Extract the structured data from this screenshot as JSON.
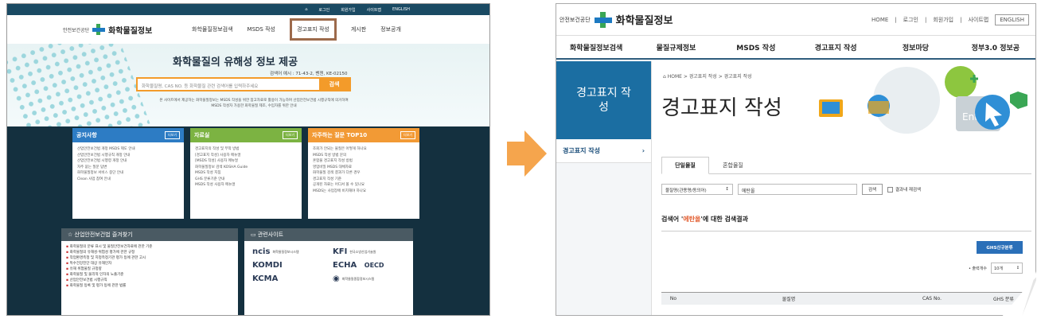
{
  "left_page": {
    "top_util": [
      "⌂",
      "로그인",
      "회원가입",
      "사이트맵",
      "ENGLISH"
    ],
    "org": "안전보건공단",
    "site_name": "화학물질정보",
    "nav": [
      "화학물질정보검색",
      "MSDS 작성",
      "경고표지 작성",
      "게시판",
      "정보공개"
    ],
    "hero_title": "화학물질의 유해성 정보 제공",
    "hero_sub": "검색어 예시 : 71-43-2, 벤젠, KE-02150",
    "search_placeholder": "화학물질명, CAS NO. 등 화학물질 관련 검색어를 입력하주세요",
    "search_btn": "검색",
    "hero_note": "본 사이트에서 제공하는 화학물질정보는 MSDS 작성을 위한 참고자료로 활용이 가능하며 산업안전보건법 시행규칙에 의거하여 MSDS 작성자 가용한 화학물질 제조, 수입자를 위한 안내",
    "cards": [
      {
        "title": "공지사항",
        "more": "더보기",
        "color": "#2d7cc4",
        "items": [
          "산업안전보건법 개정 MSDS 제도 안내",
          "산업안전보건법 시행규칙 개정 안내",
          "산업안전보건법 시행령 개정 안내",
          "자주 묻는 질문 답변",
          "화학물질정보 서비스 중단 안내",
          "Clean 사업 참여 안내"
        ]
      },
      {
        "title": "자료실",
        "more": "더보기",
        "color": "#7cb342",
        "items": [
          "경고표지의 작성 및 부착 방법",
          "[경고표지 작성] 사용자 메뉴얼",
          "[MSDS 작성] 사용자 메뉴얼",
          "화학물질정보 검색 KOSHA Guide",
          "MSDS 작성 지침",
          "GHS 분류기준 안내",
          "MSDS 작성 사용자 메뉴얼"
        ]
      },
      {
        "title": "자주하는 질문 TOP10",
        "more": "더보기",
        "color": "#f29a35",
        "items": [
          "조회가 안되는 물질은 어떻게 하나요",
          "MSDS 작성 방법 문의",
          "혼합물 경고표지 작성 방법",
          "영업비밀 MSDS 대체자료",
          "화학물질 검색 결과가 다른 경우",
          "경고표지 작성 기준",
          "공개된 자료는 어디서 볼 수 있나요",
          "MSDS는 사업장에 비치해야 하나요"
        ]
      }
    ],
    "links_title": "산업안전보건법 즐겨찾기",
    "links": [
      "화학물질의 분류 표시 및 물질안전보건자료에 관한 기준",
      "화학물질의 유해성·위험성 평가에 관한 규정",
      "작업환경측정 및 지정측정기관 평가 등에 관한 고시",
      "특수건강진단 대상 유해인자",
      "유해 위험물질 규정량",
      "화학물질 및 물리적 인자의 노출기준",
      "산업안전보건법 시행규칙",
      "화학물질 등록 및 평가 등에 관한 법률"
    ],
    "sites_title": "관련사이트",
    "sites": [
      {
        "logo": "ncis",
        "label": "화학물질정보시스템"
      },
      {
        "logo": "KFI",
        "label": "한국소방산업기술원"
      },
      {
        "logo": "KOMDI",
        "label": ""
      },
      {
        "logo": "ECHA",
        "label": ""
      },
      {
        "logo": "KCMA",
        "label": ""
      },
      {
        "logo": "◉",
        "label": "화학물질종합정보시스템"
      }
    ],
    "oecd": "OECD"
  },
  "right_page": {
    "org": "안전보건공단",
    "site_name": "화학물질정보",
    "util": [
      "HOME",
      "로그인",
      "회원가입",
      "사이트맵"
    ],
    "english": "ENGLISH",
    "nav": [
      "화학물질정보검색",
      "물질규제정보",
      "MSDS 작성",
      "경고표지 작성",
      "정보마당",
      "정부3.0 정보공"
    ],
    "side_title": "경고표지 작성",
    "side_item": "경고표지 작성",
    "breadcrumb": "⌂ HOME > 경고표지 작성 > 경고표지 작성",
    "page_title": "경고표지 작성",
    "deco_text": "Enter",
    "tabs": [
      "단일물질",
      "혼합물질"
    ],
    "select_value": "물질명(관용명/동의어)",
    "select_arrow": "↕",
    "search_value": "에탄올",
    "search_btn": "검색",
    "recheck_label": "결과내 재검색",
    "result_prefix": "검색어 '",
    "result_term": "에탄올",
    "result_suffix": "'에 대한 검색결과",
    "ghs_btn": "GHS신규분류",
    "count_label": "• 출력개수",
    "count_value": "10개",
    "table_headers": [
      "No",
      "물질명",
      "CAS No.",
      "GHS 분류"
    ]
  }
}
